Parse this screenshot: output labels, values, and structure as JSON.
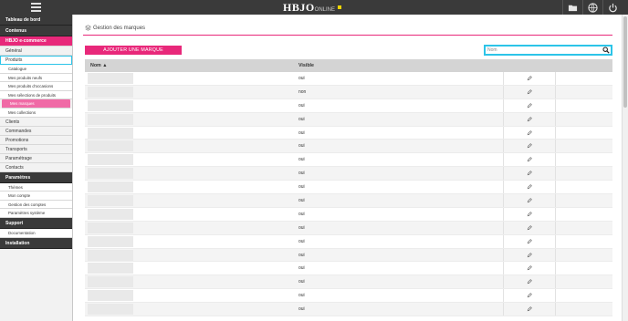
{
  "header": {
    "logo_text": "HBJO",
    "logo_sub": "ONLINE",
    "accent_color": "#e8287a",
    "highlight_color": "#2cc4e8"
  },
  "sidebar": {
    "items": [
      {
        "label": "Tableau de bord",
        "style": "dark"
      },
      {
        "label": "Contenus",
        "style": "dark"
      },
      {
        "label": "HBJO e-commerce",
        "style": "pink"
      },
      {
        "label": "Général",
        "style": "normal"
      },
      {
        "label": "Produits",
        "style": "selected"
      },
      {
        "label": "Catalogue",
        "style": "sub"
      },
      {
        "label": "Mes produits neufs",
        "style": "sub"
      },
      {
        "label": "Mes produits d'occasions",
        "style": "sub"
      },
      {
        "label": "Mes sélections de produits",
        "style": "sub"
      },
      {
        "label": "Mes marques",
        "style": "active"
      },
      {
        "label": "Mes collections",
        "style": "sub"
      },
      {
        "label": "Clients",
        "style": "normal"
      },
      {
        "label": "Commandes",
        "style": "normal"
      },
      {
        "label": "Promotions",
        "style": "normal"
      },
      {
        "label": "Transports",
        "style": "normal"
      },
      {
        "label": "Paramétrage",
        "style": "normal"
      },
      {
        "label": "Contacts",
        "style": "normal"
      },
      {
        "label": "Paramètres",
        "style": "dark"
      },
      {
        "label": "Thèmes",
        "style": "sub"
      },
      {
        "label": "Mon compte",
        "style": "sub"
      },
      {
        "label": "Gestion des comptes",
        "style": "sub"
      },
      {
        "label": "Paramètres système",
        "style": "sub"
      },
      {
        "label": "Support",
        "style": "dark"
      },
      {
        "label": "Documentation",
        "style": "sub"
      },
      {
        "label": "Installation",
        "style": "dark"
      }
    ]
  },
  "main": {
    "page_title": "Gestion des marques",
    "add_button": "AJOUTER UNE MARQUE",
    "search_placeholder": "Nom",
    "columns": {
      "name": "Nom ▲",
      "visible": "Visible"
    },
    "rows": [
      {
        "visible": "oui"
      },
      {
        "visible": "non"
      },
      {
        "visible": "oui"
      },
      {
        "visible": "oui"
      },
      {
        "visible": "oui"
      },
      {
        "visible": "oui"
      },
      {
        "visible": "oui"
      },
      {
        "visible": "oui"
      },
      {
        "visible": "oui"
      },
      {
        "visible": "oui"
      },
      {
        "visible": "oui"
      },
      {
        "visible": "oui"
      },
      {
        "visible": "oui"
      },
      {
        "visible": "oui"
      },
      {
        "visible": "oui"
      },
      {
        "visible": "oui"
      },
      {
        "visible": "oui"
      },
      {
        "visible": "oui"
      }
    ]
  }
}
